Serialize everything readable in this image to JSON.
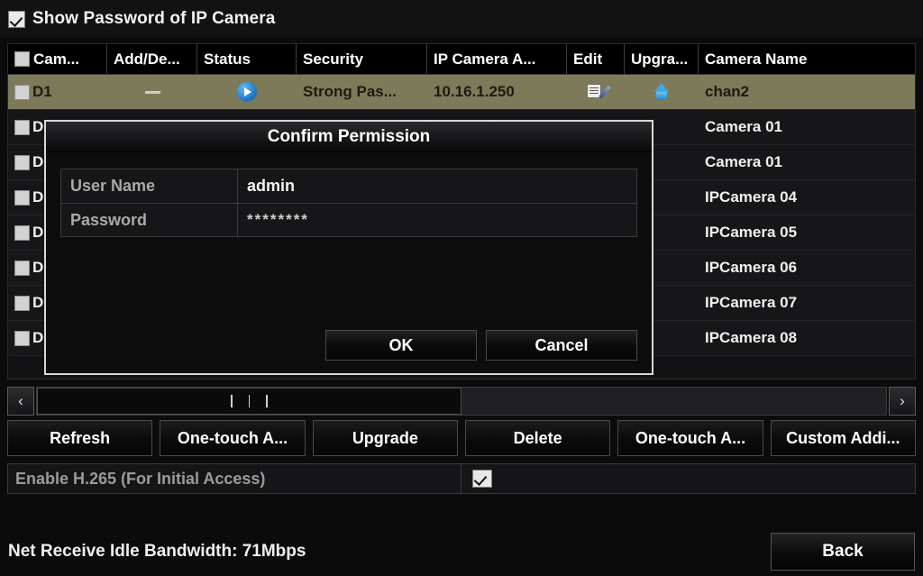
{
  "show_password": {
    "label": "Show Password of IP Camera",
    "checked": true
  },
  "table": {
    "columns": [
      {
        "key": "camera",
        "label": "Cam...",
        "has_checkbox": true
      },
      {
        "key": "add_delete",
        "label": "Add/De..."
      },
      {
        "key": "status",
        "label": "Status"
      },
      {
        "key": "security",
        "label": "Security"
      },
      {
        "key": "ip_camera_addr",
        "label": "IP Camera A..."
      },
      {
        "key": "edit",
        "label": "Edit"
      },
      {
        "key": "upgrade",
        "label": "Upgra..."
      },
      {
        "key": "camera_name",
        "label": "Camera Name"
      }
    ],
    "rows": [
      {
        "channel": "D1",
        "selected": true,
        "checked": false,
        "add_delete": "dash-icon",
        "status": "play-icon",
        "security": "Strong Pas...",
        "ip": "10.16.1.250",
        "edit": "edit-icon",
        "upgrade": "upgrade-icon",
        "name": "chan2"
      },
      {
        "channel": "D",
        "selected": false,
        "checked": false,
        "add_delete": "",
        "status": "",
        "security": "",
        "ip": "",
        "edit": "",
        "upgrade": "",
        "name": "Camera 01"
      },
      {
        "channel": "D",
        "selected": false,
        "checked": false,
        "add_delete": "",
        "status": "",
        "security": "",
        "ip": "",
        "edit": "",
        "upgrade": "",
        "name": "Camera 01"
      },
      {
        "channel": "D",
        "selected": false,
        "checked": false,
        "add_delete": "",
        "status": "",
        "security": "",
        "ip": "",
        "edit": "",
        "upgrade": "",
        "name": "IPCamera 04"
      },
      {
        "channel": "D",
        "selected": false,
        "checked": false,
        "add_delete": "",
        "status": "",
        "security": "",
        "ip": "",
        "edit": "",
        "upgrade": "",
        "name": "IPCamera 05"
      },
      {
        "channel": "D",
        "selected": false,
        "checked": false,
        "add_delete": "",
        "status": "",
        "security": "",
        "ip": "",
        "edit": "",
        "upgrade": "",
        "name": "IPCamera 06"
      },
      {
        "channel": "D",
        "selected": false,
        "checked": false,
        "add_delete": "",
        "status": "",
        "security": "",
        "ip": "",
        "edit": "",
        "upgrade": "",
        "name": "IPCamera 07"
      },
      {
        "channel": "D",
        "selected": false,
        "checked": false,
        "add_delete": "",
        "status": "",
        "security": "",
        "ip": "",
        "edit": "",
        "upgrade": "",
        "name": "IPCamera 08"
      }
    ]
  },
  "scrollbar": {
    "left_arrow": "‹",
    "right_arrow": "›"
  },
  "toolbar": {
    "buttons": [
      "Refresh",
      "One-touch A...",
      "Upgrade",
      "Delete",
      "One-touch A...",
      "Custom Addi..."
    ]
  },
  "h265": {
    "label": "Enable H.265 (For Initial Access)",
    "checked": true
  },
  "footer": {
    "net_info": "Net Receive Idle Bandwidth: 71Mbps",
    "back_label": "Back"
  },
  "dialog": {
    "title": "Confirm Permission",
    "fields": [
      {
        "label": "User Name",
        "value": "admin"
      },
      {
        "label": "Password",
        "value": "********"
      }
    ],
    "ok_label": "OK",
    "cancel_label": "Cancel"
  },
  "colors": {
    "selected_row": "#7d7a5a",
    "accent_blue": "#1472c4",
    "background": "#0b0b0c"
  }
}
